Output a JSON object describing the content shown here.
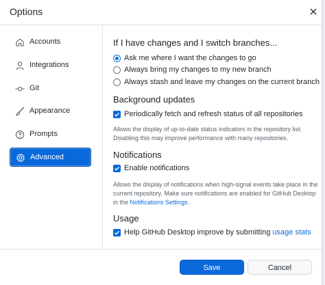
{
  "window": {
    "title": "Options"
  },
  "sidebar": {
    "items": [
      {
        "label": "Accounts",
        "icon": "home-icon",
        "active": false
      },
      {
        "label": "Integrations",
        "icon": "person-icon",
        "active": false
      },
      {
        "label": "Git",
        "icon": "git-commit-icon",
        "active": false
      },
      {
        "label": "Appearance",
        "icon": "paintbrush-icon",
        "active": false
      },
      {
        "label": "Prompts",
        "icon": "question-icon",
        "active": false
      },
      {
        "label": "Advanced",
        "icon": "gear-icon",
        "active": true
      }
    ]
  },
  "main": {
    "branches": {
      "heading": "If I have changes and I switch branches...",
      "options": [
        {
          "label": "Ask me where I want the changes to go",
          "selected": true
        },
        {
          "label": "Always bring my changes to my new branch",
          "selected": false
        },
        {
          "label": "Always stash and leave my changes on the current branch",
          "selected": false
        }
      ]
    },
    "background": {
      "heading": "Background updates",
      "checkbox_label": "Periodically fetch and refresh status of all repositories",
      "checked": true,
      "description": "Allows the display of up-to-date status indicators in the repository list. Disabling this may improve performance with many repositories."
    },
    "notifications": {
      "heading": "Notifications",
      "checkbox_label": "Enable notifications",
      "checked": true,
      "description_before": "Allows the display of notifications when high-signal events take place in the current repository. Make sure notifications are enabled for GitHub Desktop in the ",
      "description_link": "Notifications Settings",
      "description_after": "."
    },
    "usage": {
      "heading": "Usage",
      "checkbox_label": "Help GitHub Desktop improve by submitting ",
      "link": "usage stats",
      "checked": true
    }
  },
  "footer": {
    "save_label": "Save",
    "cancel_label": "Cancel"
  },
  "colors": {
    "accent": "#0969da",
    "text": "#24292e",
    "muted": "#57606a",
    "border": "#d0d7de"
  }
}
